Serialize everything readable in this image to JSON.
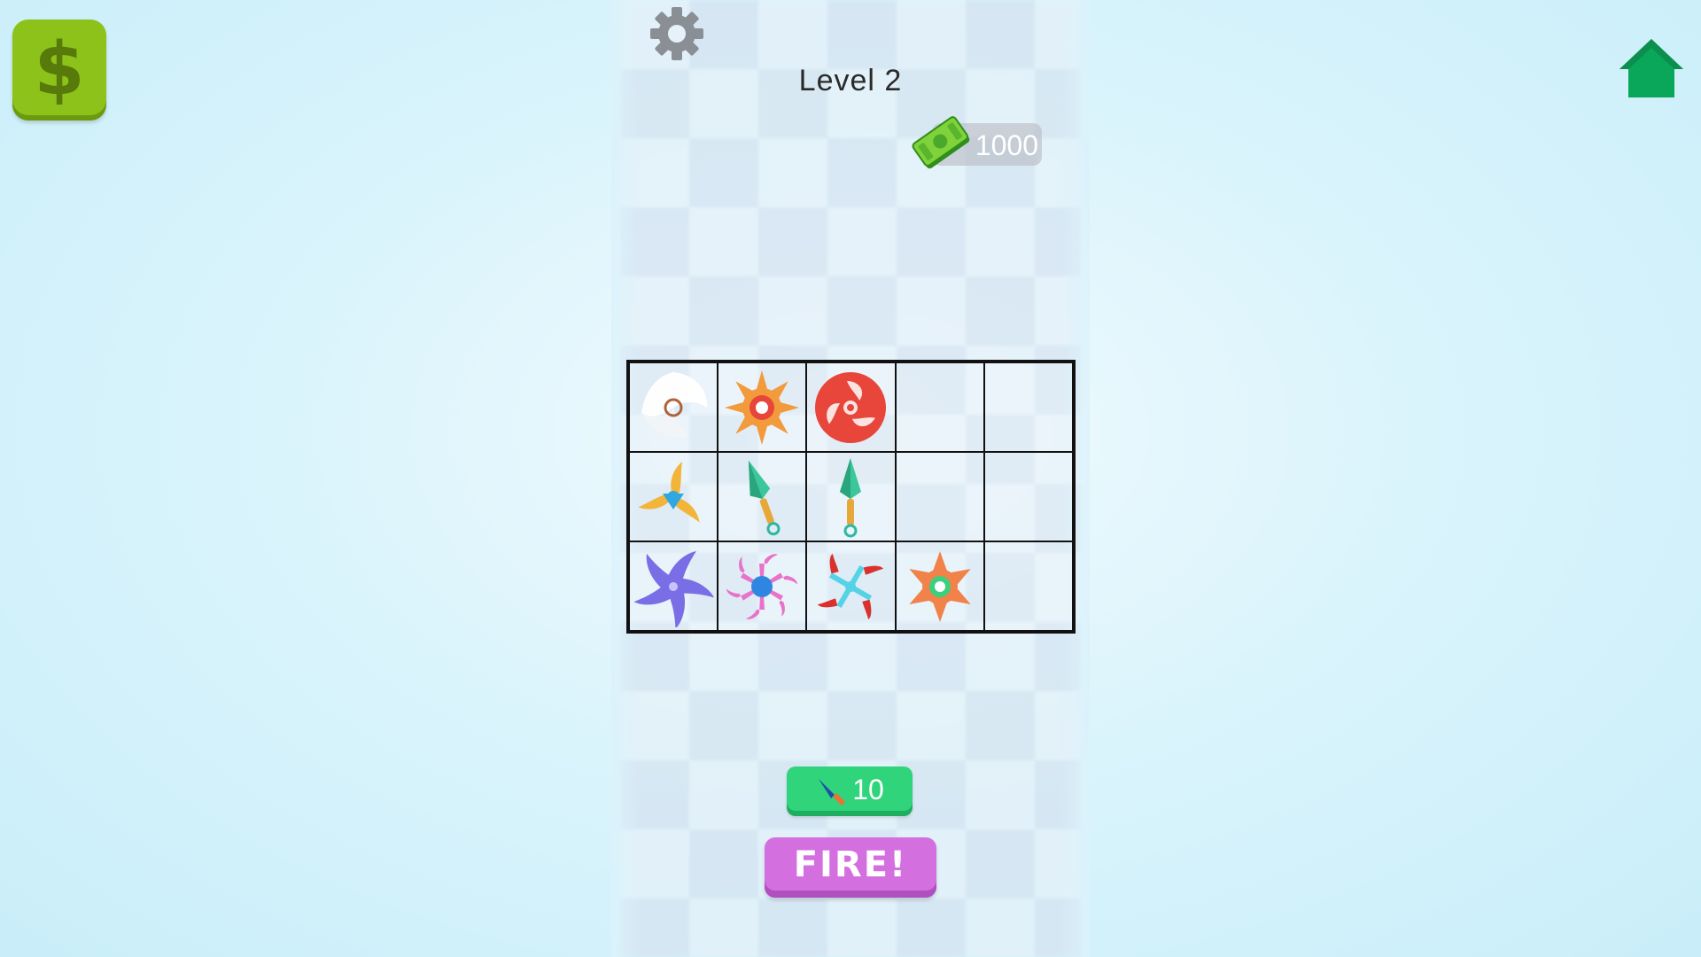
{
  "header": {
    "level_label": "Level 2",
    "money": "1000"
  },
  "controls": {
    "shop_icon": "dollar-icon",
    "settings_icon": "gear-icon",
    "home_icon": "home-icon",
    "ammo_count": "10",
    "ammo_icon": "knife-icon",
    "fire_label": "FIRE!"
  },
  "board": {
    "columns": 5,
    "rows": 3,
    "cells": [
      [
        "round-white-shuriken",
        "orange-star-shuriken",
        "red-spiral-shuriken",
        "empty",
        "empty"
      ],
      [
        "three-blade-yellow-shuriken",
        "green-kunai",
        "green-kunai",
        "empty",
        "empty"
      ],
      [
        "purple-swirl-shuriken",
        "blue-pink-claw-shuriken",
        "cyan-red-claw-shuriken",
        "orange-green-star-shuriken",
        "empty"
      ]
    ]
  },
  "colors": {
    "shop_button": "#8cc21a",
    "home_icon": "#0aa65a",
    "ammo_button": "#2fd47b",
    "fire_button": "#d46fe0",
    "money_pill": "#b4b4be"
  }
}
